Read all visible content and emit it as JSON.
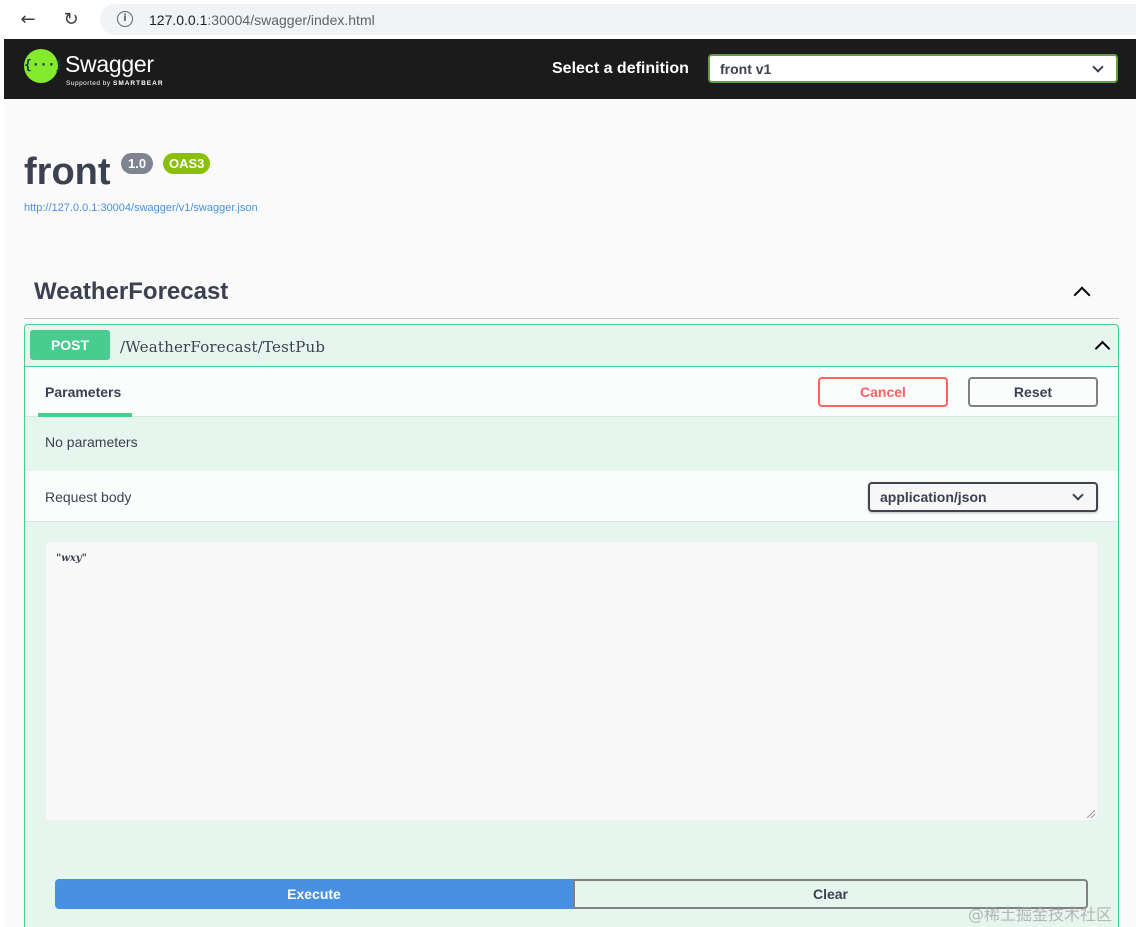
{
  "browser": {
    "back_glyph": "←",
    "reload_glyph": "↻",
    "info_glyph": "i",
    "url_host": "127.0.0.1",
    "url_rest": ":30004/swagger/index.html"
  },
  "topbar": {
    "logo_glyph": "{···}",
    "logo_name": "Swagger",
    "logo_sub_prefix": "Supported by ",
    "logo_sub_brand": "SMARTBEAR",
    "select_label": "Select a definition",
    "selected_definition": "front v1"
  },
  "info": {
    "title": "front",
    "version": "1.0",
    "oas": "OAS3",
    "spec_url": "http://127.0.0.1:30004/swagger/v1/swagger.json"
  },
  "tag": {
    "name": "WeatherForecast"
  },
  "operation": {
    "method": "POST",
    "path": "/WeatherForecast/TestPub",
    "method_color": "#49cc90",
    "parameters_tab": "Parameters",
    "cancel_label": "Cancel",
    "reset_label": "Reset",
    "no_parameters": "No parameters",
    "request_body_label": "Request body",
    "content_type": "application/json",
    "body_value": "\"wxy\"",
    "execute_label": "Execute",
    "clear_label": "Clear"
  },
  "icons": {
    "back": "arrow-left-icon",
    "reload": "reload-icon",
    "info": "info-icon",
    "collapse": "chevron-up-icon",
    "dropdown": "chevron-down-icon"
  },
  "watermark": "@稀土掘金技术社区"
}
